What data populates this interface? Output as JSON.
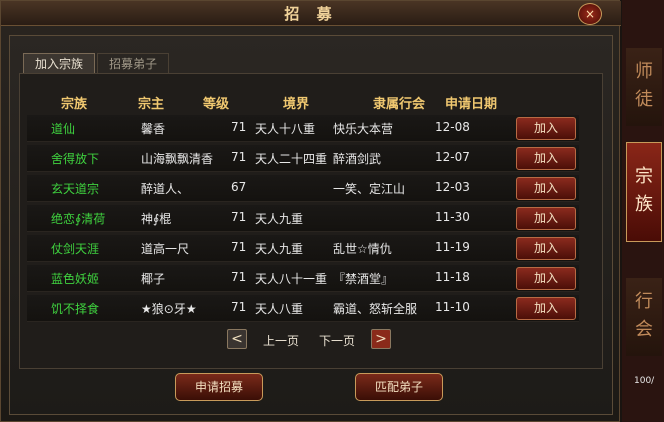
{
  "window": {
    "title": "招 募",
    "close": "×"
  },
  "tabs": [
    {
      "label": "加入宗族",
      "active": true
    },
    {
      "label": "招募弟子",
      "active": false
    }
  ],
  "columns": {
    "clan": "宗族",
    "leader": "宗主",
    "level": "等级",
    "realm": "境界",
    "guild": "隶属行会",
    "date": "申请日期"
  },
  "rows": [
    {
      "name": "道仙",
      "leader": "馨香",
      "level": "71",
      "realm": "天人十八重",
      "guild": "快乐大本营",
      "date": "12-08",
      "action": "加入"
    },
    {
      "name": "舍得放下",
      "leader": "山海飘飘清香",
      "level": "71",
      "realm": "天人二十四重",
      "guild": "醉酒剑武",
      "date": "12-07",
      "action": "加入"
    },
    {
      "name": "玄天道宗",
      "leader": "醉道人、",
      "level": "67",
      "realm": "",
      "guild": "一笑、定江山",
      "date": "12-03",
      "action": "加入"
    },
    {
      "name": "绝恋∮清荷",
      "leader": "神∮棍",
      "level": "71",
      "realm": "天人九重",
      "guild": "",
      "date": "11-30",
      "action": "加入"
    },
    {
      "name": "仗剑天涯",
      "leader": "道高一尺",
      "level": "71",
      "realm": "天人九重",
      "guild": "乱世☆情仇",
      "date": "11-19",
      "action": "加入"
    },
    {
      "name": "蓝色妖姬",
      "leader": "椰子",
      "level": "71",
      "realm": "天人八十一重",
      "guild": "『禁酒堂』",
      "date": "11-18",
      "action": "加入"
    },
    {
      "name": "饥不择食",
      "leader": "★狼⊙牙★",
      "level": "71",
      "realm": "天人八重",
      "guild": "霸道、怒斩全服",
      "date": "11-10",
      "action": "加入"
    }
  ],
  "pagination": {
    "prev_icon": "<",
    "prev": "上一页",
    "next": "下一页",
    "next_icon": ">"
  },
  "buttons": {
    "apply": "申请招募",
    "match": "匹配弟子"
  },
  "side_tabs": [
    {
      "label": "师徒",
      "chars": [
        "师",
        "徒"
      ],
      "active": false
    },
    {
      "label": "宗族",
      "chars": [
        "宗",
        "族"
      ],
      "active": true
    },
    {
      "label": "行会",
      "chars": [
        "行",
        "会"
      ],
      "active": false
    }
  ],
  "side_text": "100/"
}
